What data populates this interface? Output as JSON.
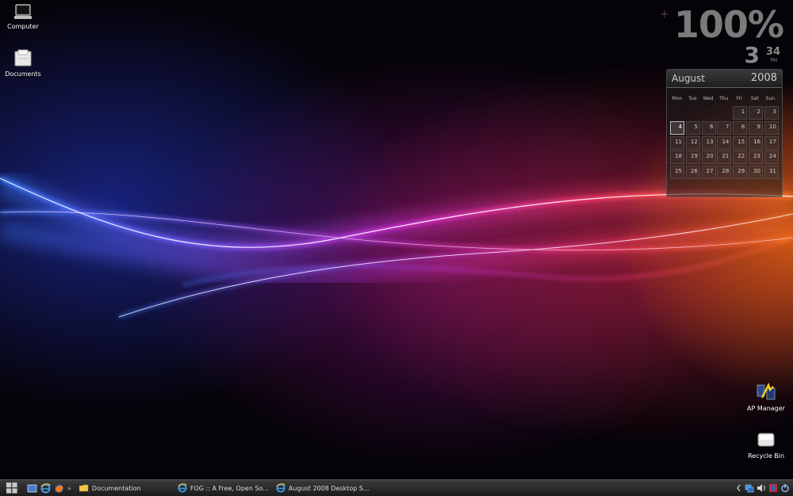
{
  "desktop": {
    "icons_left": [
      {
        "label": "Computer",
        "icon": "computer-icon"
      },
      {
        "label": "Documents",
        "icon": "documents-icon"
      }
    ],
    "icons_right": [
      {
        "label": "AP Manager",
        "icon": "ap-manager-icon"
      },
      {
        "label": "Recycle Bin",
        "icon": "recycle-bin-icon"
      }
    ]
  },
  "widgets": {
    "gauge": {
      "plus": "+",
      "percent": "100%"
    },
    "clock": {
      "hour": "3",
      "minute": "34",
      "ampm": "PM"
    },
    "calendar": {
      "month": "August",
      "year": "2008",
      "weekdays": [
        "Mon",
        "Tue",
        "Wed",
        "Thu",
        "Fri",
        "Sat",
        "Sun"
      ],
      "leading_blanks": 4,
      "days": [
        "1",
        "2",
        "3",
        "4",
        "5",
        "6",
        "7",
        "8",
        "9",
        "10",
        "11",
        "12",
        "13",
        "14",
        "15",
        "16",
        "17",
        "18",
        "19",
        "20",
        "21",
        "22",
        "23",
        "24",
        "25",
        "26",
        "27",
        "28",
        "29",
        "30",
        "31"
      ],
      "today": "4"
    }
  },
  "taskbar": {
    "start_icon": "windows-start-icon",
    "quick_launch": [
      "show-desktop-icon",
      "internet-explorer-icon",
      "firefox-icon"
    ],
    "quick_launch_more": "»",
    "tasks": [
      {
        "label": "Documentation",
        "icon": "folder-icon"
      },
      {
        "label": "FOG :: A Free, Open So...",
        "icon": "internet-explorer-icon"
      },
      {
        "label": "August 2008 Desktop S...",
        "icon": "internet-explorer-icon"
      }
    ],
    "tray": [
      "tray-arrow-icon",
      "network-icon",
      "volume-icon",
      "security-icon",
      "power-icon"
    ]
  }
}
